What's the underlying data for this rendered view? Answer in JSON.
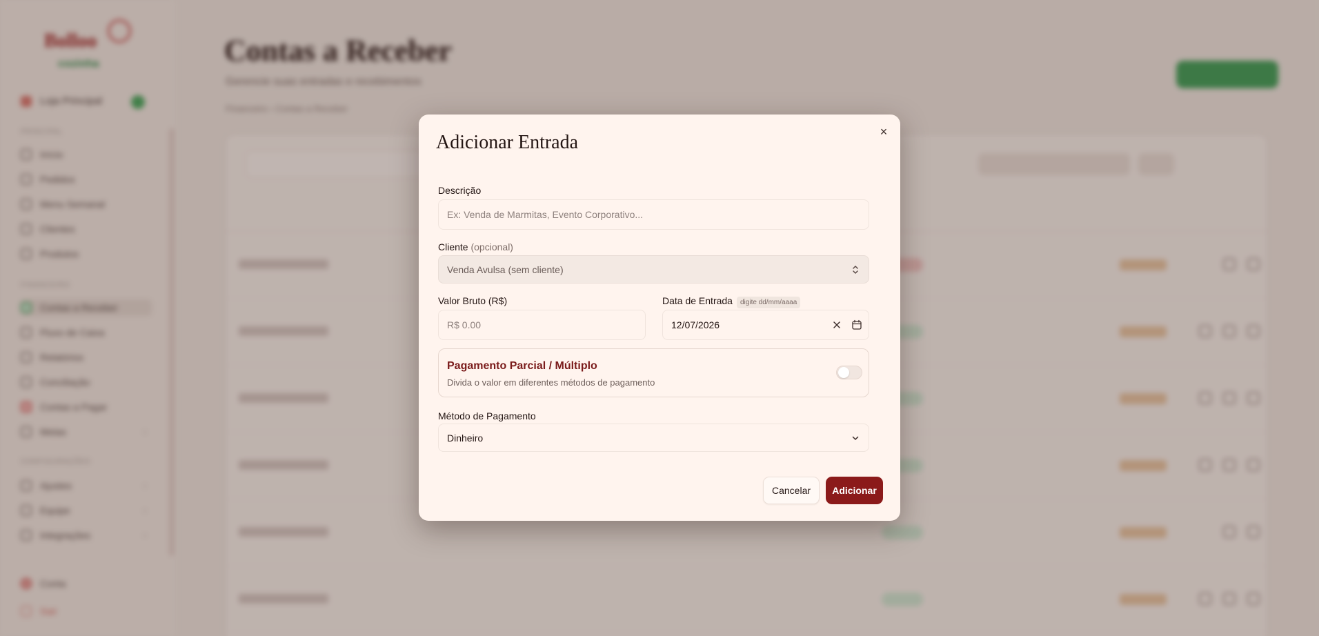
{
  "modal": {
    "title": "Adicionar Entrada",
    "close_icon": "×",
    "descricao": {
      "label": "Descrição",
      "placeholder": "Ex: Venda de Marmitas, Evento Corporativo..."
    },
    "cliente": {
      "label": "Cliente",
      "label_optional": "(opcional)",
      "selected": "Venda Avulsa (sem cliente)"
    },
    "valor_bruto": {
      "label": "Valor Bruto (R$)",
      "placeholder": "R$ 0.00"
    },
    "data_entrada": {
      "label": "Data de Entrada",
      "hint": "digite dd/mm/aaaa",
      "value": "12/07/2026"
    },
    "pagamento_parcial": {
      "title": "Pagamento Parcial / Múltiplo",
      "description": "Divida o valor em diferentes métodos de pagamento",
      "enabled": false
    },
    "metodo_pagamento": {
      "label": "Método de Pagamento",
      "selected": "Dinheiro"
    },
    "buttons": {
      "cancel": "Cancelar",
      "submit": "Adicionar"
    }
  },
  "background": {
    "page_title": "Contas a Receber"
  },
  "colors": {
    "accent": "#8b1a1a",
    "modal_bg": "#fff4ee",
    "overlay": "rgba(60,40,35,0.30)",
    "success": "#3e9d55"
  },
  "icons": {
    "close": "close-icon",
    "calendar": "calendar-icon",
    "clear": "clear-icon",
    "select": "chevron-updown-icon",
    "dropdown": "chevron-down-icon"
  }
}
